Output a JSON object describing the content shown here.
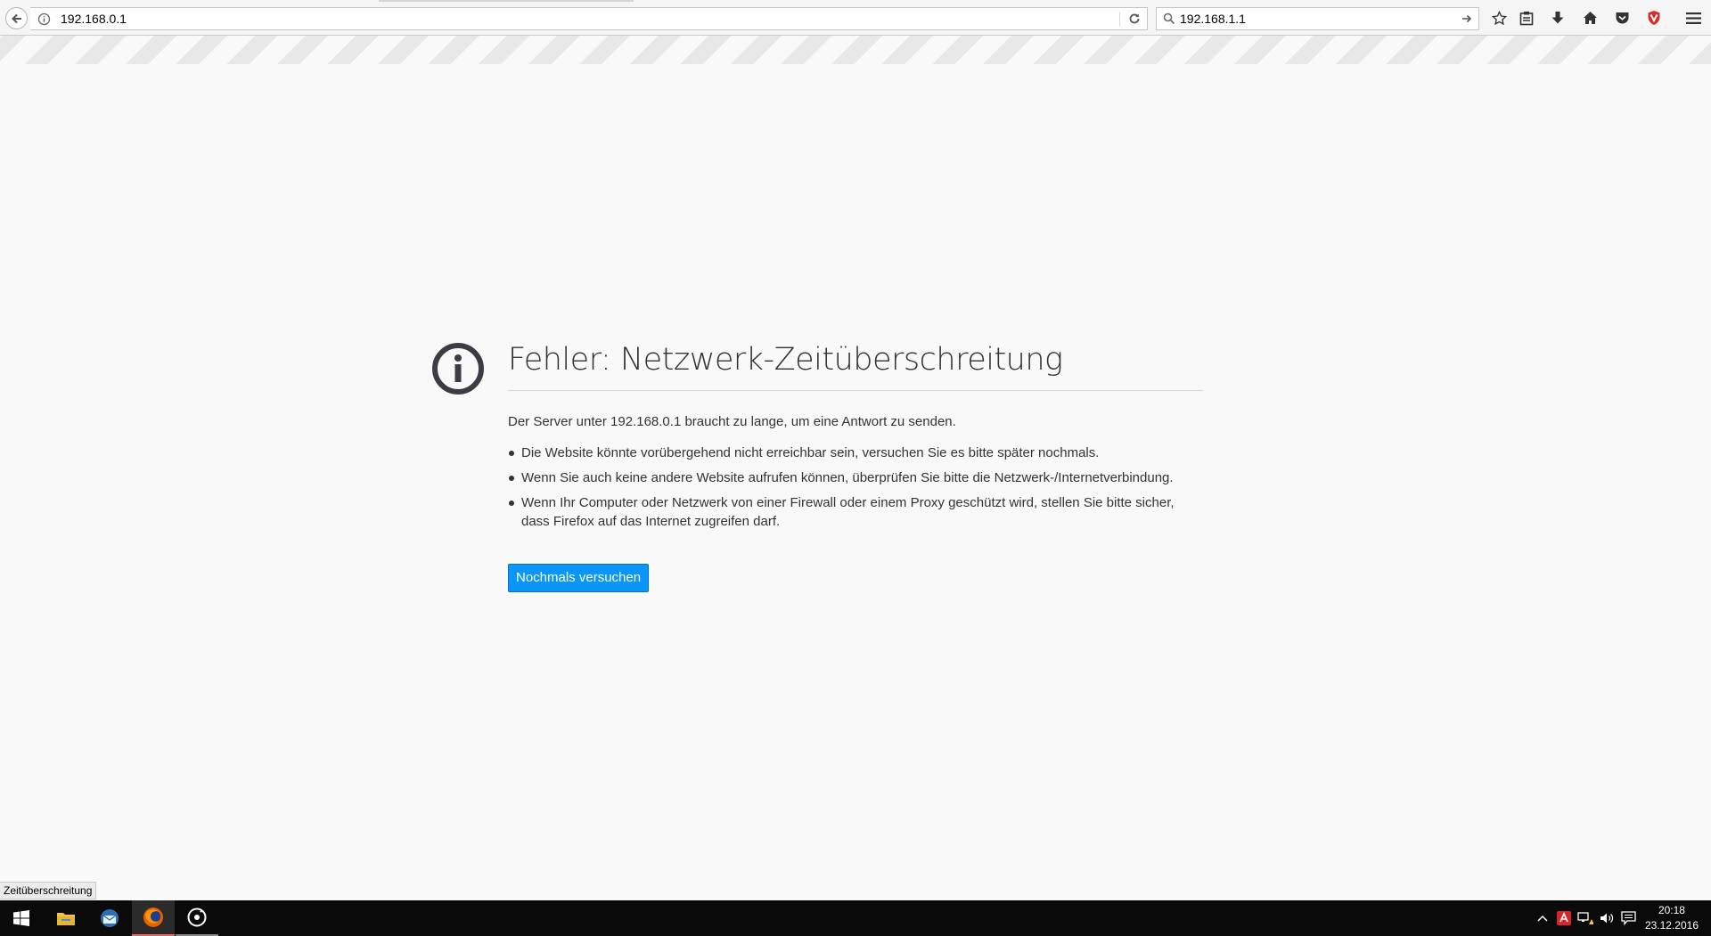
{
  "browser": {
    "url": "192.168.0.1",
    "search_value": "192.168.1.1",
    "icons": {
      "back": "back-arrow-icon",
      "site_info": "info-icon",
      "reload": "reload-icon",
      "search": "search-icon",
      "go": "go-arrow-icon",
      "bookmark": "star-icon",
      "reading_list": "clipboard-icon",
      "downloads": "download-icon",
      "home": "home-icon",
      "pocket": "pocket-icon",
      "adblock": "shield-icon",
      "menu": "hamburger-menu-icon"
    }
  },
  "error_page": {
    "title": "Fehler: Netzwerk-Zeitüberschreitung",
    "description": "Der Server unter 192.168.0.1 braucht zu lange, um eine Antwort zu senden.",
    "items": [
      "Die Website könnte vorübergehend nicht erreichbar sein, versuchen Sie es bitte später nochmals.",
      "Wenn Sie auch keine andere Website aufrufen können, überprüfen Sie bitte die Netzwerk-/Internetverbindung.",
      "Wenn Ihr Computer oder Netzwerk von einer Firewall oder einem Proxy geschützt wird, stellen Sie bitte sicher, dass Firefox auf das Internet zugreifen darf."
    ],
    "retry_label": "Nochmals versuchen",
    "accent_color": "#0996f8"
  },
  "status_tooltip": "Zeitüberschreitung",
  "taskbar": {
    "apps": [
      "windows-start",
      "file-explorer",
      "thunderbird",
      "firefox",
      "media-app"
    ],
    "time": "20:18",
    "date": "23.12.2016"
  }
}
